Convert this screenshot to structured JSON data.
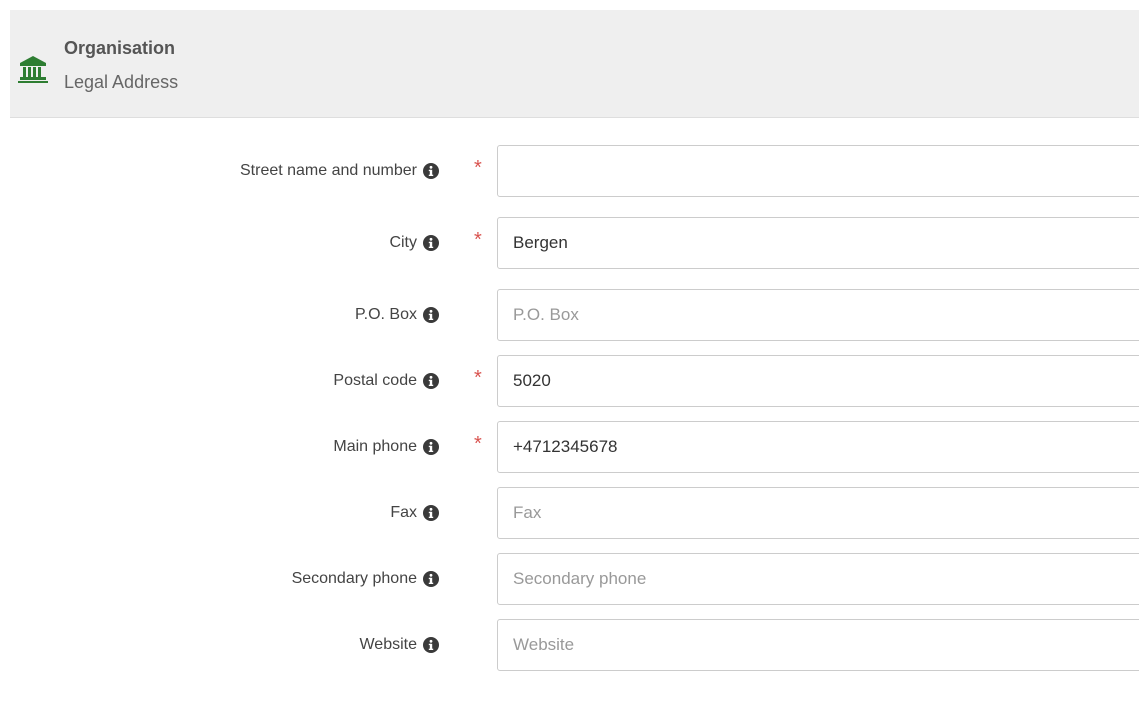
{
  "header": {
    "title": "Organisation",
    "subtitle": "Legal Address",
    "icon": "institution-icon",
    "icon_color": "#2e7d32"
  },
  "required_mark": "*",
  "form": {
    "fields": [
      {
        "label": "Street name and number",
        "value": "",
        "placeholder": "",
        "required": true
      },
      {
        "label": "City",
        "value": "Bergen",
        "placeholder": "",
        "required": true
      },
      {
        "label": "P.O. Box",
        "value": "",
        "placeholder": "P.O. Box",
        "required": false
      },
      {
        "label": "Postal code",
        "value": "5020",
        "placeholder": "",
        "required": true
      },
      {
        "label": "Main phone",
        "value": "+4712345678",
        "placeholder": "",
        "required": true
      },
      {
        "label": "Fax",
        "value": "",
        "placeholder": "Fax",
        "required": false
      },
      {
        "label": "Secondary phone",
        "value": "",
        "placeholder": "Secondary phone",
        "required": false
      },
      {
        "label": "Website",
        "value": "",
        "placeholder": "Website",
        "required": false
      }
    ]
  },
  "colors": {
    "required": "#d9534f",
    "header_bg": "#efefef",
    "border": "#cccccc"
  }
}
